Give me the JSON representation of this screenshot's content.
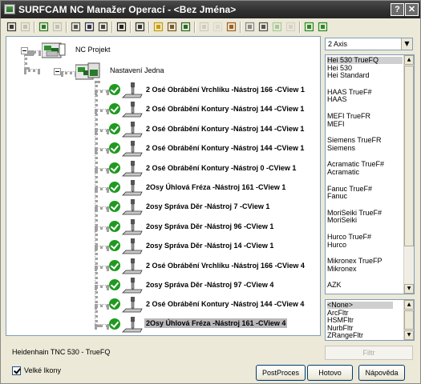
{
  "window": {
    "title": "SURFCAM NC Manažer Operací - <Bez Jména>",
    "help_label": "?",
    "close_label": "✕"
  },
  "toolbar": {
    "icons": [
      "expand-all-icon",
      "collapse-all-icon",
      "copy-op-icon",
      "paste-op-icon",
      "cut-icon",
      "copy-icon",
      "paste-icon",
      "delete-icon",
      "time-icon",
      "verify-icon",
      "tool-info-icon",
      "nc-post-icon",
      "regen-icon",
      "edit-icon",
      "sort-icon",
      "new-file-icon",
      "save-icon",
      "group-icon",
      "ungroup-icon",
      "move-up-icon",
      "move-down-icon"
    ]
  },
  "tree": {
    "root_label": "NC Projekt",
    "setup_label": "Nastavení Jedna",
    "operations": [
      {
        "label": "2 Osé Obrábění Vrchlíku  -Nástroj 166 -CView 1",
        "selected": false
      },
      {
        "label": "2 Osé Obrábění Kontury  -Nástroj 144 -CView 1",
        "selected": false
      },
      {
        "label": "2 Osé Obrábění Kontury  -Nástroj 144 -CView 1",
        "selected": false
      },
      {
        "label": "2 Osé Obrábění Kontury  -Nástroj 144 -CView 1",
        "selected": false
      },
      {
        "label": "2 Osé Obrábění Kontury  -Nástroj 0 -CView 1",
        "selected": false
      },
      {
        "label": "2Osy Úhlová Fréza  -Nástroj 161 -CView 1",
        "selected": false
      },
      {
        "label": "2osy Správa Děr  -Nástroj 7 -CView 1",
        "selected": false
      },
      {
        "label": "2osy Správa Děr  -Nástroj 96 -CView 1",
        "selected": false
      },
      {
        "label": "2osy Správa Děr  -Nástroj 14 -CView 1",
        "selected": false
      },
      {
        "label": "2 Osé Obrábění Vrchlíku  -Nástroj 166 -CView 4",
        "selected": false
      },
      {
        "label": "2osy Správa Děr  -Nástroj 97 -CView 4",
        "selected": false
      },
      {
        "label": "2 Osé Obrábění Kontury  -Nástroj 144 -CView 4",
        "selected": false
      },
      {
        "label": "2Osy Úhlová Fréza  -Nástroj 161 -CView 4",
        "selected": true
      }
    ]
  },
  "axis_select": {
    "value": "2 Axis",
    "arrow": "▼"
  },
  "post_list": {
    "items": [
      {
        "label": "Hei 530 TrueFQ",
        "selected": true,
        "gap_before": false
      },
      {
        "label": "Hei 530",
        "selected": false,
        "gap_before": false
      },
      {
        "label": "Hei Standard",
        "selected": false,
        "gap_before": false
      },
      {
        "label": "HAAS TrueF#",
        "selected": false,
        "gap_before": true
      },
      {
        "label": "HAAS",
        "selected": false,
        "gap_before": false
      },
      {
        "label": "MEFI TrueFR",
        "selected": false,
        "gap_before": true
      },
      {
        "label": "MEFI",
        "selected": false,
        "gap_before": false
      },
      {
        "label": "Siemens TrueFR",
        "selected": false,
        "gap_before": true
      },
      {
        "label": "Siemens",
        "selected": false,
        "gap_before": false
      },
      {
        "label": "Acramatic TrueF#",
        "selected": false,
        "gap_before": true
      },
      {
        "label": "Acramatic",
        "selected": false,
        "gap_before": false
      },
      {
        "label": "Fanuc TrueF#",
        "selected": false,
        "gap_before": true
      },
      {
        "label": "Fanuc",
        "selected": false,
        "gap_before": false
      },
      {
        "label": "MoriSeiki TrueF#",
        "selected": false,
        "gap_before": true
      },
      {
        "label": "MoriSeiki",
        "selected": false,
        "gap_before": false
      },
      {
        "label": "Hurco TrueF#",
        "selected": false,
        "gap_before": true
      },
      {
        "label": "Hurco",
        "selected": false,
        "gap_before": false
      },
      {
        "label": "Mikronex TrueFP",
        "selected": false,
        "gap_before": true
      },
      {
        "label": "Mikronex",
        "selected": false,
        "gap_before": false
      },
      {
        "label": "AZK",
        "selected": false,
        "gap_before": true
      }
    ]
  },
  "filter_list": {
    "items": [
      {
        "label": "<None>",
        "selected": true
      },
      {
        "label": "ArcFltr",
        "selected": false
      },
      {
        "label": "HSMFltr",
        "selected": false
      },
      {
        "label": "NurbFltr",
        "selected": false
      },
      {
        "label": "ZRangeFltr",
        "selected": false
      }
    ]
  },
  "filter_button_label": "Filtr",
  "status_text": "Heidenhain TNC 530 - TrueFQ",
  "large_icons": {
    "label": "Velké Ikony",
    "checked": true
  },
  "buttons": {
    "postproces": "PostProces",
    "done": "Hotovo",
    "help": "Nápověda"
  }
}
